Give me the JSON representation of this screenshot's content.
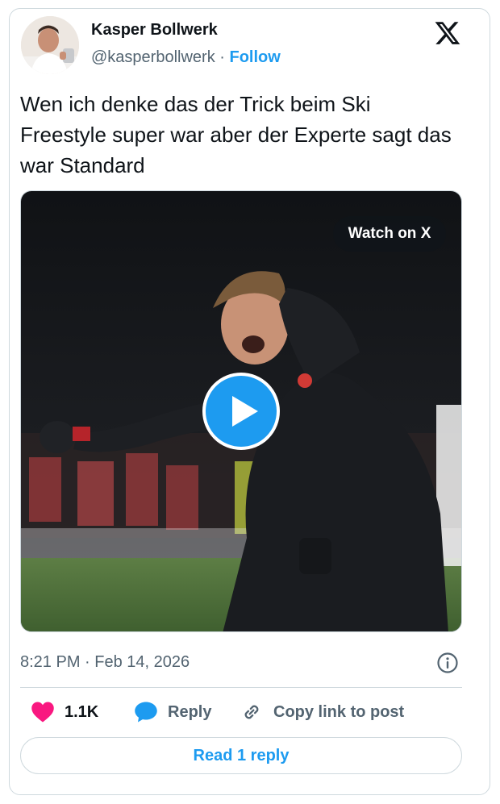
{
  "author": {
    "name": "Kasper Bollwerk",
    "handle": "@kasperbollwerk",
    "separator": "·",
    "follow_label": "Follow"
  },
  "tweet": {
    "text": "Wen ich denke das der Trick beim Ski Freestyle super war aber der Experte sagt das war Standard",
    "timestamp": "8:21 PM · Feb 14, 2026"
  },
  "media": {
    "watch_label": "Watch on X"
  },
  "actions": {
    "like_count": "1.1K",
    "reply_label": "Reply",
    "copy_label": "Copy link to post",
    "read_replies_label": "Read 1 reply"
  },
  "icons": {
    "logo": "x-logo-icon",
    "play": "play-icon",
    "info": "info-icon",
    "like": "heart-icon",
    "reply": "speech-bubble-icon",
    "copy": "link-icon"
  },
  "colors": {
    "accent": "#1d9bf0",
    "like": "#f91880",
    "muted": "#536471",
    "border": "#cfd9de"
  }
}
